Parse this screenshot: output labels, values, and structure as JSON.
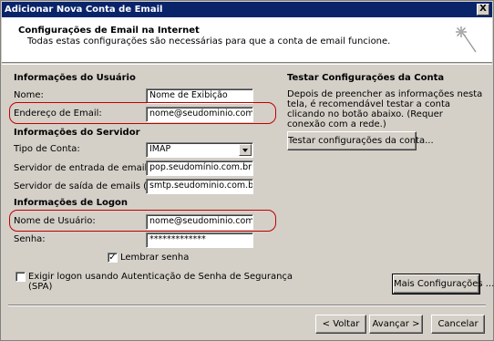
{
  "window": {
    "title": "Adicionar Nova Conta de Email",
    "close_glyph": "X"
  },
  "header": {
    "title": "Configurações de Email na Internet",
    "subtitle": "Todas estas configurações são necessárias para que a conta de email funcione."
  },
  "user_info": {
    "section_title": "Informações do Usuário",
    "name_label": "Nome:",
    "name_value": "Nome de Exibição",
    "email_label": "Endereço de Email:",
    "email_value": "nome@seudominio.com.br"
  },
  "server_info": {
    "section_title": "Informações do Servidor",
    "account_type_label": "Tipo de Conta:",
    "account_type_value": "IMAP",
    "incoming_label": "Servidor de entrada de emails:",
    "incoming_value": "pop.seudomínio.com.br",
    "outgoing_label": "Servidor de saída de emails (SMTP):",
    "outgoing_value": "smtp.seudominio.com.br"
  },
  "logon_info": {
    "section_title": "Informações de Logon",
    "username_label": "Nome de Usuário:",
    "username_value": "nome@seudominio.com.br",
    "password_label": "Senha:",
    "password_value": "*************",
    "remember_label": "Lembrar senha",
    "remember_checked": "✓",
    "spa_label_1": "Exigir logon usando Autenticação de Senha de Segurança",
    "spa_label_2": "(SPA)"
  },
  "test": {
    "section_title": "Testar Configurações da Conta",
    "description": "Depois de preencher as informações nesta tela, é recomendável testar a conta clicando no botão abaixo. (Requer conexão com a rede.)",
    "test_button": "Testar configurações da conta..."
  },
  "buttons": {
    "more_settings": "Mais Configurações ...",
    "back": "< Voltar",
    "next": "Avançar >",
    "cancel": "Cancelar"
  },
  "colors": {
    "titlebar": "#0a246a",
    "highlight": "#c00000",
    "dialog": "#d4d0c8"
  },
  "icons": {
    "header": "sparkle-wizard-icon"
  }
}
